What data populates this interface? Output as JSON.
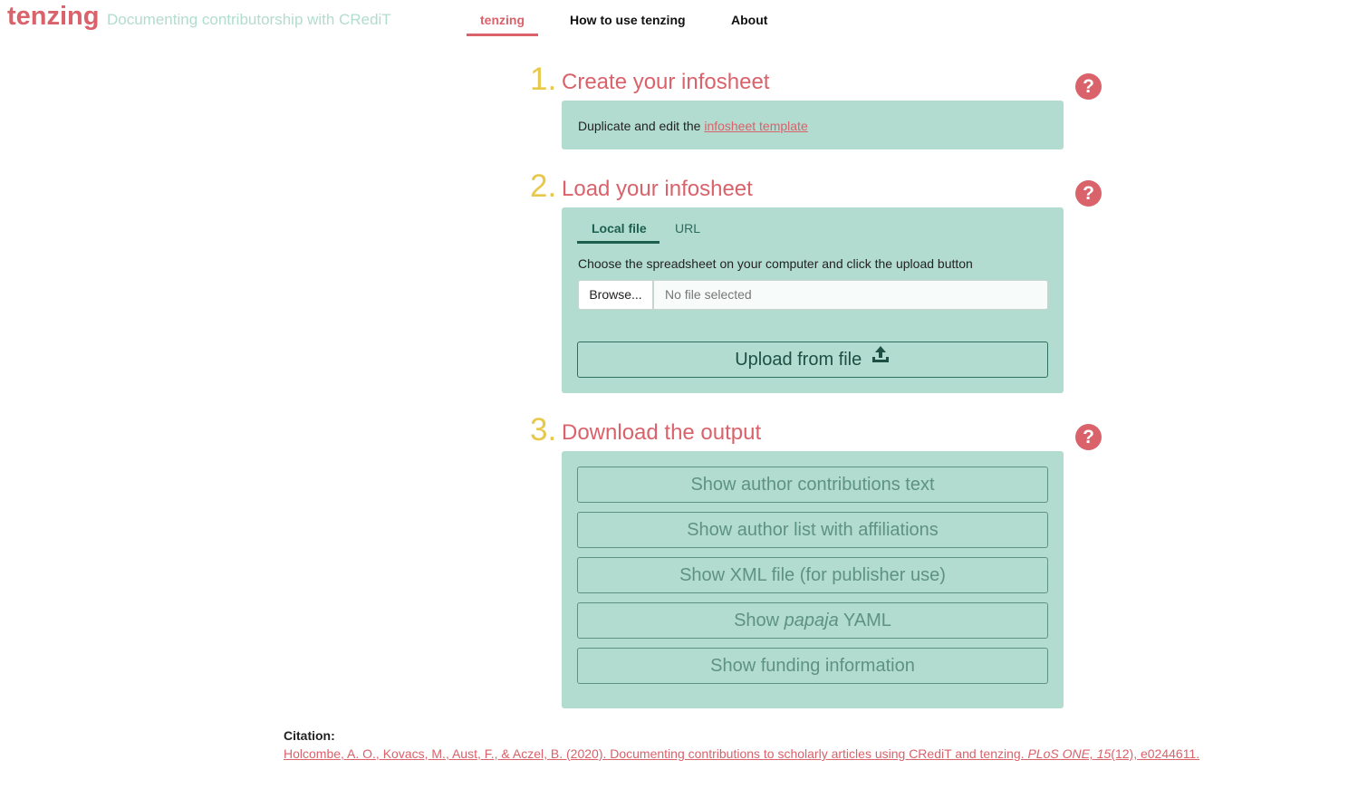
{
  "header": {
    "brand": "tenzing",
    "tagline": "Documenting contributorship with CRediT",
    "nav": [
      {
        "label": "tenzing",
        "active": true
      },
      {
        "label": "How to use tenzing",
        "active": false
      },
      {
        "label": "About",
        "active": false
      }
    ]
  },
  "steps": [
    {
      "number": "1.",
      "title": "Create your infosheet",
      "help": "?"
    },
    {
      "number": "2.",
      "title": "Load your infosheet",
      "help": "?"
    },
    {
      "number": "3.",
      "title": "Download the output",
      "help": "?"
    }
  ],
  "step1": {
    "text": "Duplicate and edit the ",
    "link": "infosheet template"
  },
  "step2": {
    "tabs": [
      {
        "label": "Local file",
        "active": true
      },
      {
        "label": "URL",
        "active": false
      }
    ],
    "instruction": "Choose the spreadsheet on your computer and click the upload button",
    "browse_label": "Browse...",
    "file_placeholder": "No file selected",
    "upload_label": "Upload from file",
    "upload_icon": "upload-icon"
  },
  "step3": {
    "buttons": [
      "Show author contributions text",
      "Show author list with affiliations",
      "Show XML file (for publisher use)",
      {
        "prefix": "Show ",
        "italic": "papaja",
        "suffix": " YAML"
      },
      "Show funding information"
    ]
  },
  "citation": {
    "label": "Citation:",
    "text_before": "Holcombe, A. O., Kovacs, M., Aust, F., & Aczel, B. (2020). Documenting contributions to scholarly articles using CRediT and tenzing. ",
    "journal": "PLoS ONE, 15",
    "text_after": "(12), e0244611."
  },
  "colors": {
    "brand": "#d9626b",
    "accent_teal": "#b2dccf",
    "step_number": "#e8c84a",
    "dark_teal": "#1d5f4f"
  }
}
